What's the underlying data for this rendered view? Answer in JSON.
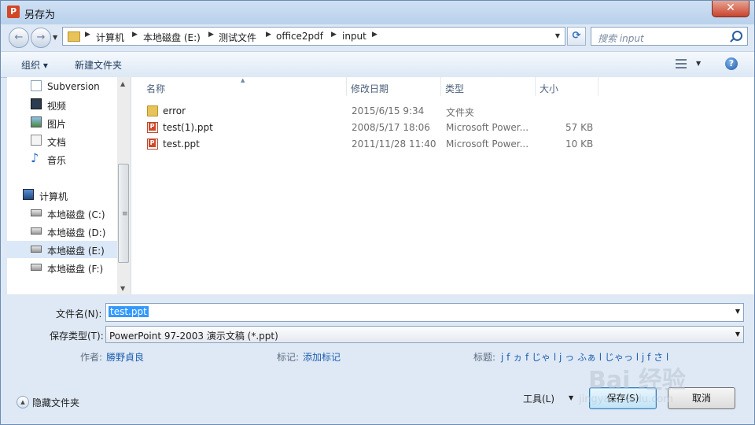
{
  "window": {
    "title": "另存为",
    "app_icon": "P",
    "close": "✕"
  },
  "nav": {
    "back": "←",
    "forward": "→",
    "breadcrumbs": [
      "计算机",
      "本地磁盘 (E:)",
      "测试文件",
      "office2pdf",
      "input"
    ],
    "refresh": "⟳",
    "search_placeholder": "搜索 input"
  },
  "toolbar": {
    "organize": "组织 ▾",
    "new_folder": "新建文件夹",
    "help": "?"
  },
  "sidebar": {
    "items": [
      {
        "label": "Subversion",
        "icon": "subversion-icon"
      },
      {
        "label": "视频",
        "icon": "video-library-icon"
      },
      {
        "label": "图片",
        "icon": "picture-library-icon"
      },
      {
        "label": "文档",
        "icon": "document-library-icon"
      },
      {
        "label": "音乐",
        "icon": "music-library-icon"
      },
      {
        "label": "计算机",
        "icon": "computer-icon"
      },
      {
        "label": "本地磁盘 (C:)",
        "icon": "system-drive-icon"
      },
      {
        "label": "本地磁盘 (D:)",
        "icon": "drive-icon"
      },
      {
        "label": "本地磁盘 (E:)",
        "icon": "drive-icon",
        "selected": true
      },
      {
        "label": "本地磁盘 (F:)",
        "icon": "drive-icon"
      }
    ]
  },
  "file_list": {
    "columns": [
      "名称",
      "修改日期",
      "类型",
      "大小"
    ],
    "rows": [
      {
        "name": "error",
        "date": "2015/6/15 9:34",
        "type": "文件夹",
        "size": "",
        "icon": "folder-icon"
      },
      {
        "name": "test(1).ppt",
        "date": "2008/5/17 18:06",
        "type": "Microsoft Power...",
        "size": "57 KB",
        "icon": "ppt-file-icon"
      },
      {
        "name": "test.ppt",
        "date": "2011/11/28 11:40",
        "type": "Microsoft Power...",
        "size": "10 KB",
        "icon": "ppt-file-icon"
      }
    ]
  },
  "form": {
    "filename_label": "文件名(N):",
    "filename_value": "test.ppt",
    "filetype_label": "保存类型(T):",
    "filetype_value": "PowerPoint 97-2003 演示文稿 (*.ppt)"
  },
  "metadata": {
    "author_label": "作者:",
    "author_value": "勝野貞良",
    "tags_label": "标记:",
    "tags_value": "添加标记",
    "title_label": "标题:",
    "title_value": "j f ヵ f じゃ l j っ ふぁ l じゃっ l j f さ l"
  },
  "footer": {
    "hide_folders": "隐藏文件夹",
    "tools": "工具(L)",
    "save": "保存(S)",
    "cancel": "取消"
  },
  "watermark": {
    "brand": "Bai  经验",
    "url": "jingyan.baidu.com"
  },
  "colors": {
    "accent": "#3399ff",
    "link": "#1d5fb0",
    "titlebar": "#b9d1ec"
  }
}
